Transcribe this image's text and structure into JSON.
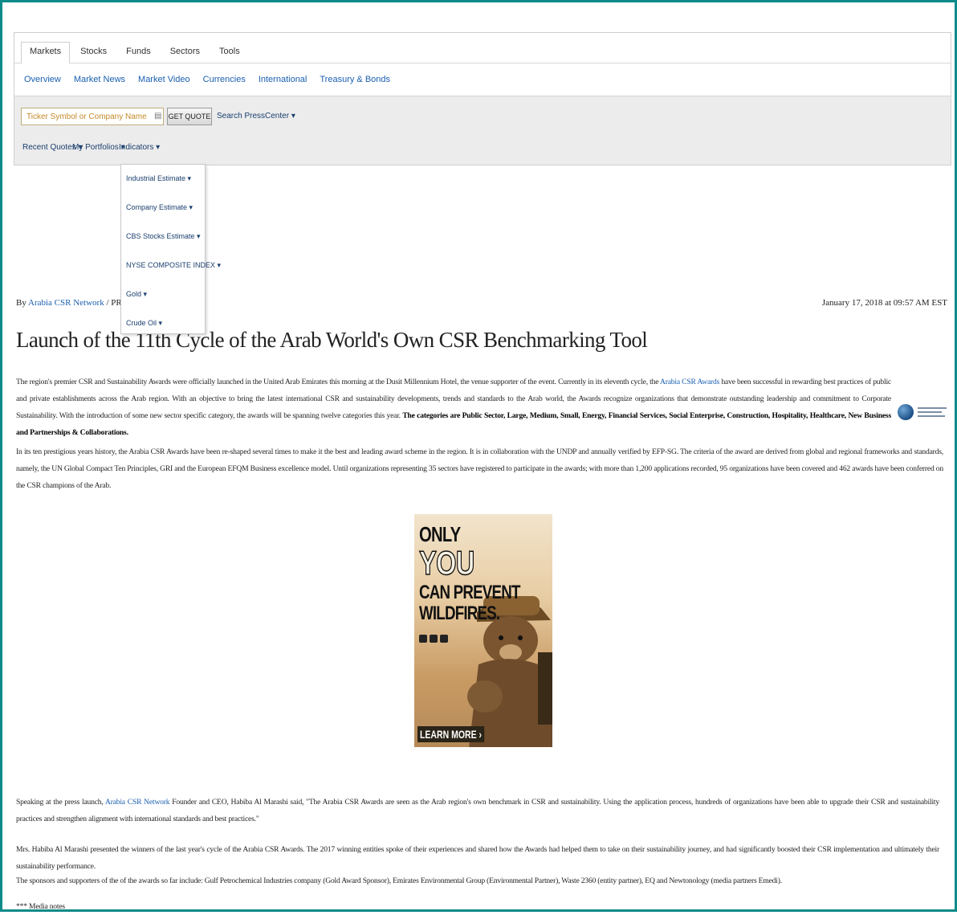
{
  "nav": {
    "top_tabs": [
      "Markets",
      "Stocks",
      "Funds",
      "Sectors",
      "Tools"
    ],
    "active_top_tab": 0,
    "sub_tabs": [
      "Overview",
      "Market News",
      "Market Video",
      "Currencies",
      "International",
      "Treasury & Bonds"
    ],
    "quote_placeholder": "Ticker Symbol or Company Name",
    "get_quote_label": "GET QUOTE",
    "search_press_label": "Search PressCenter ▾",
    "recent_quotes_label": "Recent Quotes ▾",
    "my_portfolios_label": "My Portfolios ▾",
    "indicators_label": "Indicators ▾",
    "dropdown_items": [
      "Industrial Estimate ▾",
      "Company Estimate ▾",
      "CBS Stocks Estimate ▾",
      "NYSE COMPOSITE INDEX ▾",
      "Gold ▾",
      "Crude Oil ▾"
    ]
  },
  "article": {
    "byline_prefix": "By",
    "byline_author": "Arabia CSR Network",
    "byline_rest": "/ PR Business",
    "date": "January 17, 2018 at 09:57 AM EST",
    "title": "Launch of the 11th Cycle of the Arab World's Own CSR Benchmarking Tool",
    "p1_text": "The region's premier CSR and Sustainability Awards were officially launched in the United Arab Emirates this morning at the Dusit Millennium Hotel, the venue supporter of the event. Currently in its eleventh cycle, the ",
    "p1_link": "Arabia CSR Awards",
    "p1_text2": " have been successful in rewarding best practices of public and private establishments across the Arab region. With an objective to bring the latest international CSR and sustainability developments, trends and standards to the Arab world, the Awards recognize organizations that demonstrate outstanding leadership and commitment to Corporate Sustainability. With the introduction of some new sector specific category, the awards will be spanning twelve categories this year. ",
    "p1_bold": "The categories are Public Sector, Large, Medium, Small, Energy, Financial Services, Social Enterprise, Construction, Hospitality, Healthcare, New Business and Partnerships & Collaborations.",
    "p2": "In its ten prestigious years history, the Arabia CSR Awards have been re-shaped several times to make it the best and leading award scheme in the region. It is in collaboration with the UNDP and annually verified by EFP-SG. The criteria of the award are derived from global and regional frameworks and standards, namely, the UN Global Compact Ten Principles, GRI and the European EFQM Business excellence model. Until organizations representing 35 sectors have registered to participate in the awards; with more than 1,200 applications recorded, 95 organizations have been covered and 462 awards have been conferred on the CSR champions of the Arab.",
    "p3_text": "Speaking at the press launch, ",
    "p3_link": "Arabia CSR Network",
    "p3_text2": " Founder and CEO, Habiba Al Marashi said, \"The Arabia CSR Awards are seen as the Arab region's own benchmark in CSR and sustainability. Using the application process, hundreds of organizations have been able to upgrade their CSR and sustainability practices and strengthen alignment with international standards and best practices.\"",
    "p4": "Mrs. Habiba Al Marashi presented the winners of the last year's cycle of the Arabia CSR Awards. The 2017 winning entities spoke of their experiences and shared how the Awards had helped them to take on their sustainability journey, and had significantly boosted their CSR implementation and ultimately their sustainability performance.",
    "p5": "The sponsors and supporters of the of the awards so far include: Gulf Petrochemical Industries company (Gold Award Sponsor), Emirates Environmental Group (Environmental Partner), Waste 2360 (entity partner), EQ and Newtonology (media partners Emedi).",
    "p6": "*** Media notes"
  },
  "ad": {
    "line1": "ONLY",
    "line2": "YOU",
    "line3": "CAN PREVENT",
    "line4": "WILDFIRES.",
    "cta": "LEARN MORE ›"
  },
  "colors": {
    "frame_border": "#0f8a8a",
    "link": "#1a5fb0",
    "placeholder": "#c78a2a",
    "quote_bar_bg": "#ececec"
  }
}
